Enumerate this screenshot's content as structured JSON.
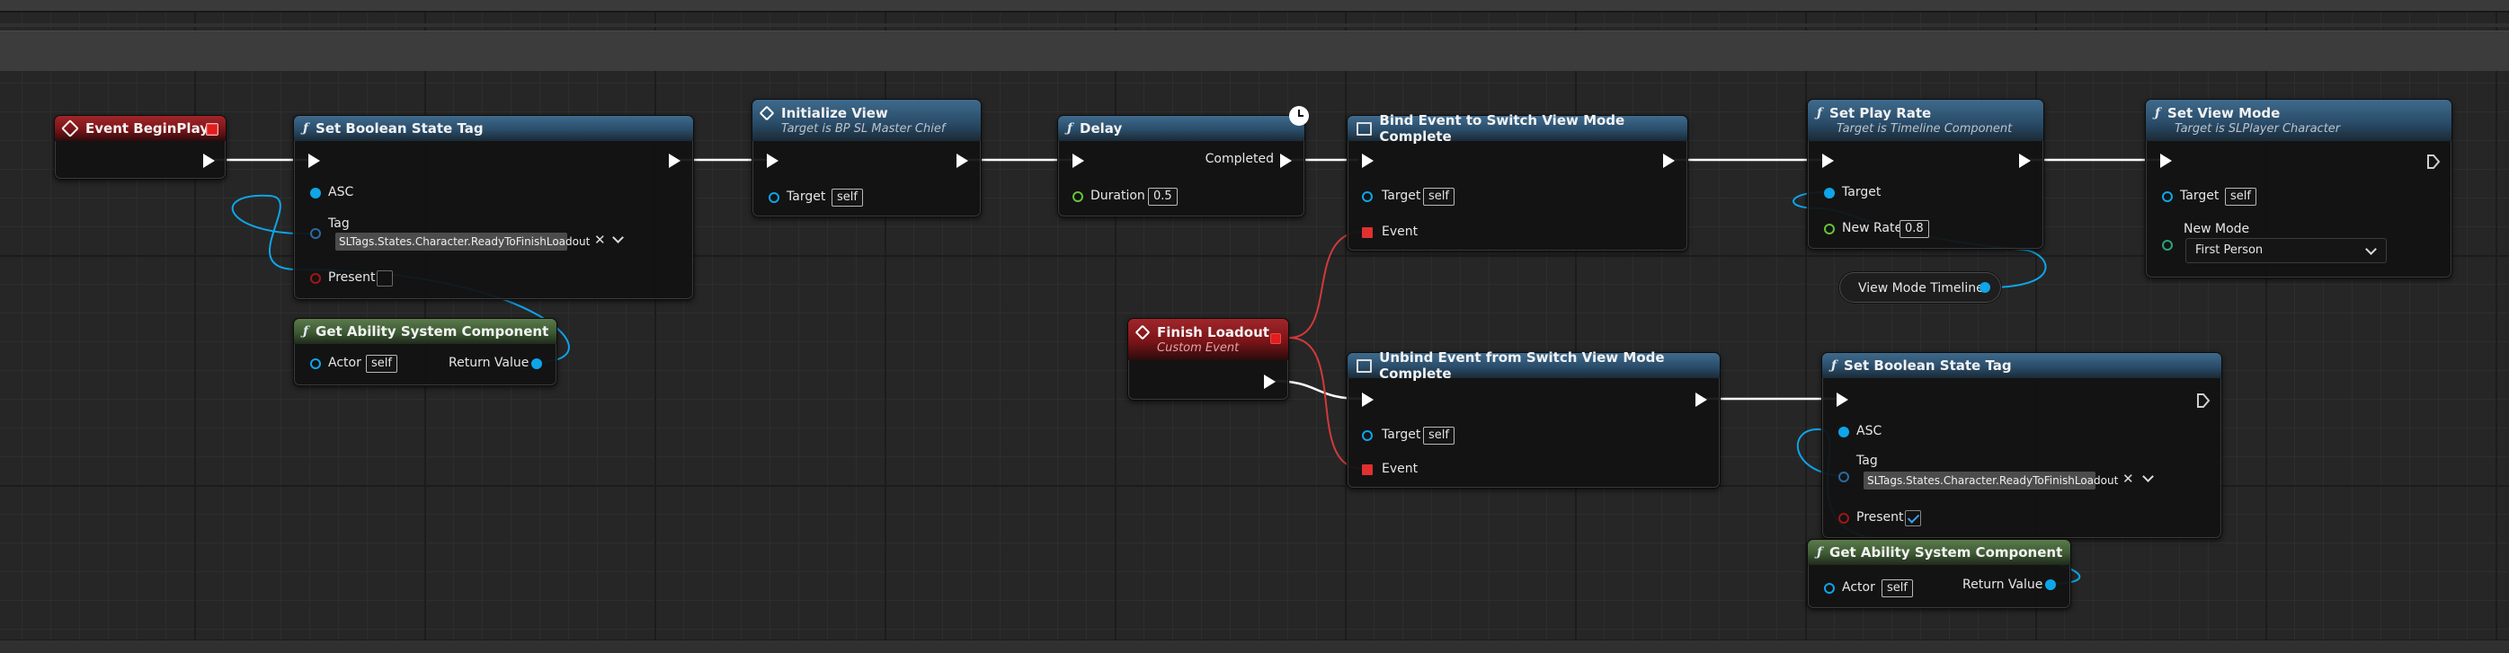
{
  "nodes": {
    "begin_play": {
      "title": "Event BeginPlay"
    },
    "set_bool_1": {
      "title": "Set Boolean State Tag",
      "asc": "ASC",
      "tag_label": "Tag",
      "tag_value": "SLTags.States.Character.ReadyToFinishLoadout",
      "present": "Present"
    },
    "get_asc_1": {
      "title": "Get Ability System Component",
      "actor": "Actor",
      "self": "self",
      "return": "Return Value"
    },
    "init_view": {
      "title": "Initialize View",
      "subtitle": "Target is BP SL Master Chief",
      "target": "Target",
      "self": "self"
    },
    "delay": {
      "title": "Delay",
      "completed": "Completed",
      "duration": "Duration",
      "duration_value": "0.5"
    },
    "bind_event": {
      "title": "Bind Event to Switch View Mode Complete",
      "target": "Target",
      "self": "self",
      "event": "Event"
    },
    "finish_loadout": {
      "title": "Finish Loadout",
      "subtitle": "Custom Event"
    },
    "unbind_event": {
      "title": "Unbind Event from Switch View Mode Complete",
      "target": "Target",
      "self": "self",
      "event": "Event"
    },
    "set_play_rate": {
      "title": "Set Play Rate",
      "subtitle": "Target is Timeline Component",
      "target": "Target",
      "new_rate": "New Rate",
      "new_rate_value": "0.8"
    },
    "view_mode_timeline": {
      "label": "View Mode Timeline"
    },
    "set_view_mode": {
      "title": "Set View Mode",
      "subtitle": "Target is SLPlayer Character",
      "target": "Target",
      "self": "self",
      "new_mode": "New Mode",
      "new_mode_value": "First Person"
    },
    "set_bool_2": {
      "title": "Set Boolean State Tag",
      "asc": "ASC",
      "tag_label": "Tag",
      "tag_value": "SLTags.States.Character.ReadyToFinishLoadout",
      "present": "Present",
      "present_checked": true
    },
    "get_asc_2": {
      "title": "Get Ability System Component",
      "actor": "Actor",
      "self": "self",
      "return": "Return Value"
    }
  },
  "icons": {
    "function": "f",
    "event": "diamond-icon",
    "latent": "clock-icon"
  },
  "colors": {
    "exec_wire": "#ffffff",
    "object_wire": "#0ea5e9",
    "delegate_wire": "#e04848",
    "function_header": "#2a4d6a",
    "pure_header": "#3d5a33",
    "event_header": "#7a1418"
  }
}
